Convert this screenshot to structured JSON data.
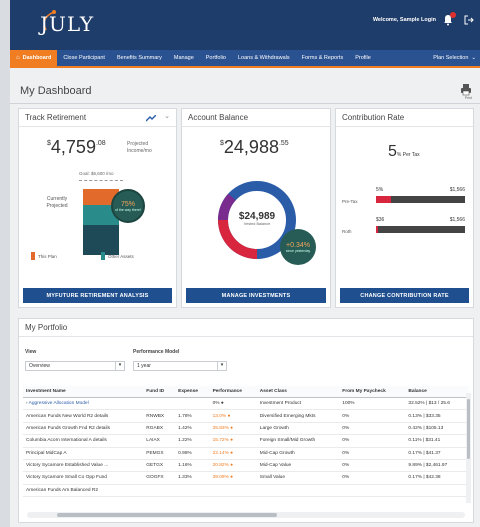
{
  "header": {
    "logo": "JULY",
    "welcome": "Welcome, Sample Login"
  },
  "nav": {
    "items": [
      "Dashboard",
      "Close Participant",
      "Benefits Summary",
      "Manage",
      "Portfolio",
      "Loans & Withdrawals",
      "Forms & Reports",
      "Profile"
    ],
    "plan_selection": "Plan Selection"
  },
  "page": {
    "title": "My Dashboard",
    "print_label": "Print"
  },
  "track": {
    "title": "Track Retirement",
    "amount_int": "4,759",
    "amount_cents": ".08",
    "amount_sup": "$",
    "projected_label": "Projected Income/mo",
    "goal_label": "Goal: $6,600 /mo",
    "currently_projected": "Currently Projected",
    "pct": "75%",
    "pct_sub": "of the way there!",
    "legend_plan": "This Plan",
    "legend_other": "Other Assets",
    "button": "MYFUTURE RETIREMENT ANALYSIS"
  },
  "balance": {
    "title": "Account Balance",
    "amount_sup": "$",
    "amount_int": "24,988",
    "amount_cents": ".55",
    "donut_value": "$24,989",
    "donut_sub": "Vested Balance",
    "gain": "+0.34%",
    "gain_sub": "since yesterday",
    "button": "MANAGE INVESTMENTS"
  },
  "contribution": {
    "title": "Contribution Rate",
    "rate": "5",
    "rate_suffix": "% Per Tax",
    "rows": [
      {
        "label": "Pre-Tax",
        "pct": "5%",
        "amount": "$1,566",
        "fill": 0.17
      },
      {
        "label": "Roth",
        "pct": "$36",
        "amount": "$1,566",
        "fill": 0.02
      }
    ],
    "button": "CHANGE CONTRIBUTION RATE"
  },
  "portfolio": {
    "title": "My Portfolio",
    "view_label": "View",
    "view_value": "Overview",
    "perf_label": "Performance Model",
    "perf_value": "1 year",
    "columns": [
      "Investment Name",
      "Fund ID",
      "Expense",
      "Performance",
      "Asset Class",
      "From My Paycheck",
      "Balance"
    ],
    "rows": [
      {
        "name": "Aggressive Allocation Model",
        "id": "",
        "expense": "",
        "perf": "0%",
        "asset": "Investment Product",
        "paycheck": "100%",
        "balance": "32.52% | $13 / 25.6"
      },
      {
        "name": "American Funds New World R2 details",
        "id": "RNWBX",
        "expense": "1.78%",
        "perf": "13.0%",
        "asset": "Diversified Emerging Mkts",
        "paycheck": "0%",
        "balance": "0.13% | $33.35"
      },
      {
        "name": "American Funds Growth Fnd R2 details",
        "id": "RGABX",
        "expense": "1.42%",
        "perf": "25.83%",
        "asset": "Large Growth",
        "paycheck": "0%",
        "balance": "0.42% | $105.13"
      },
      {
        "name": "Columbia Acorn International A details",
        "id": "LAIAX",
        "expense": "1.22%",
        "perf": "15.72%",
        "asset": "Foreign Small/Mid Growth",
        "paycheck": "0%",
        "balance": "0.11% | $31.41"
      },
      {
        "name": "Principal MidCap A",
        "id": "PEMGX",
        "expense": "0.98%",
        "perf": "22.14%",
        "asset": "Mid-Cap Growth",
        "paycheck": "0%",
        "balance": "0.17% | $41.37"
      },
      {
        "name": "Victory Sycamore Established Value ...",
        "id": "GETGX",
        "expense": "1.16%",
        "perf": "20.82%",
        "asset": "Mid-Cap Value",
        "paycheck": "0%",
        "balance": "9.89% | $2,461.97"
      },
      {
        "name": "Victory Sycamore Small Co Opp Fund",
        "id": "GOGFX",
        "expense": "1.33%",
        "perf": "39.09%",
        "asset": "Small Value",
        "paycheck": "0%",
        "balance": "0.17% | $42.38"
      },
      {
        "name": "American Funds Am Balanced R2",
        "id": "",
        "expense": "",
        "perf": "",
        "asset": "",
        "paycheck": "",
        "balance": ""
      }
    ]
  },
  "colors": {
    "navy": "#1f3d6b",
    "nav": "#2a5190",
    "accent": "#f07d22",
    "button": "#1f4f8f",
    "teal": "#2a9d8f",
    "red": "#d7263d"
  }
}
